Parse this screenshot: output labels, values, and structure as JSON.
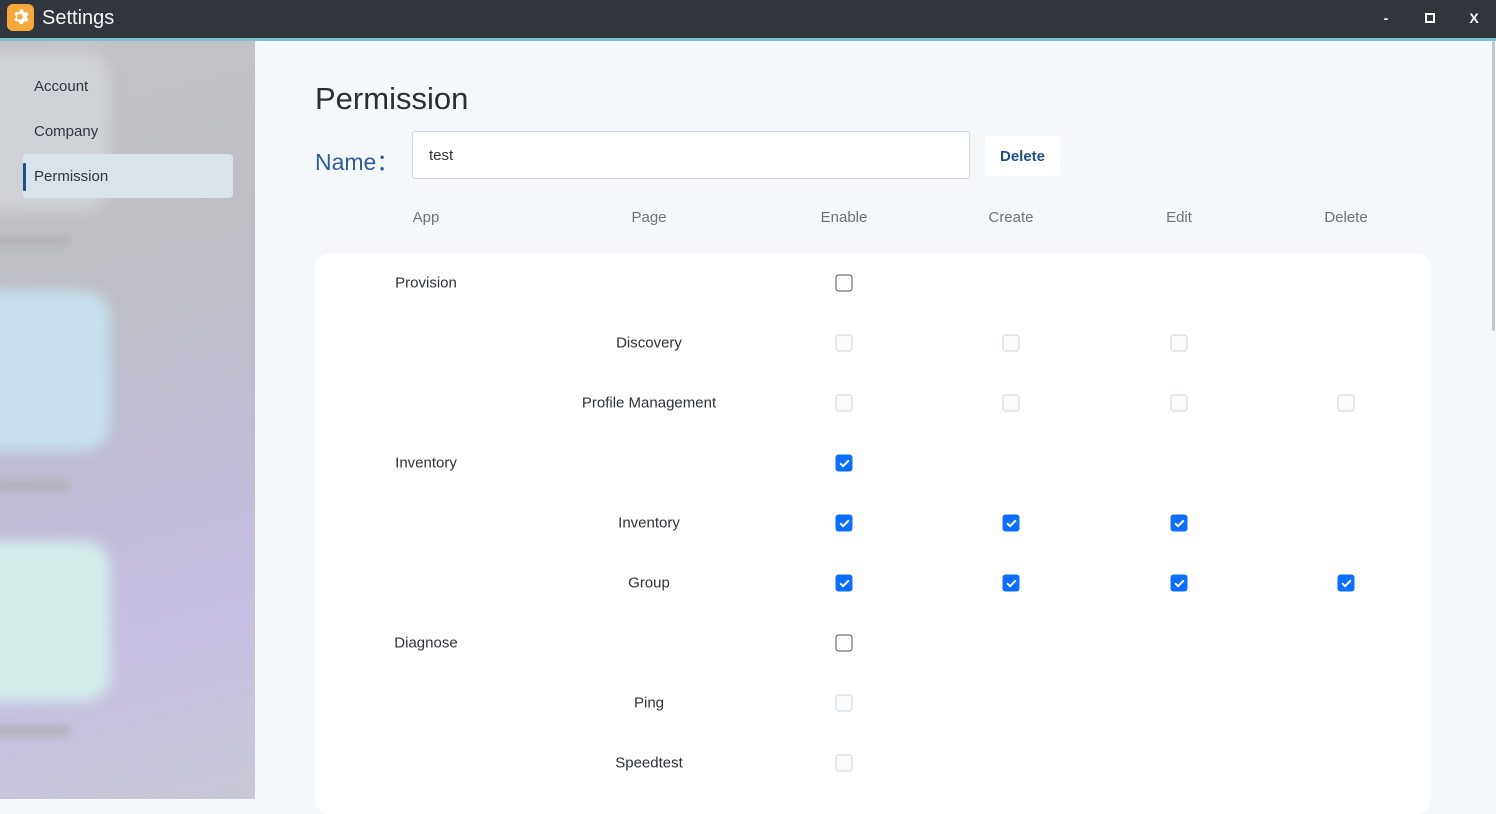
{
  "window": {
    "title": "Settings",
    "minimize": "-",
    "close": "X"
  },
  "sidebar": {
    "items": [
      {
        "label": "Account"
      },
      {
        "label": "Company"
      },
      {
        "label": "Permission"
      }
    ],
    "active": "Permission"
  },
  "main": {
    "title": "Permission",
    "name_label": "Name：",
    "name_value": "test",
    "delete_label": "Delete",
    "columns": [
      "App",
      "Page",
      "Enable",
      "Create",
      "Edit",
      "Delete"
    ],
    "rows": [
      {
        "app": "Provision",
        "page": "",
        "enable": "unchecked",
        "create": "none",
        "edit": "none",
        "delete": "none"
      },
      {
        "app": "",
        "page": "Discovery",
        "enable": "disabled",
        "create": "disabled",
        "edit": "disabled",
        "delete": "none"
      },
      {
        "app": "",
        "page": "Profile Management",
        "enable": "disabled",
        "create": "disabled",
        "edit": "disabled",
        "delete": "disabled"
      },
      {
        "app": "Inventory",
        "page": "",
        "enable": "checked",
        "create": "none",
        "edit": "none",
        "delete": "none"
      },
      {
        "app": "",
        "page": "Inventory",
        "enable": "checked",
        "create": "checked",
        "edit": "checked",
        "delete": "none"
      },
      {
        "app": "",
        "page": "Group",
        "enable": "checked",
        "create": "checked",
        "edit": "checked",
        "delete": "checked"
      },
      {
        "app": "Diagnose",
        "page": "",
        "enable": "unchecked",
        "create": "none",
        "edit": "none",
        "delete": "none"
      },
      {
        "app": "",
        "page": "Ping",
        "enable": "disabled",
        "create": "none",
        "edit": "none",
        "delete": "none"
      },
      {
        "app": "",
        "page": "Speedtest",
        "enable": "disabled",
        "create": "none",
        "edit": "none",
        "delete": "none"
      }
    ]
  },
  "colors": {
    "accent": "#0d6efd",
    "title_bar": "#31363d",
    "label_blue": "#2f5d9a"
  },
  "icons": {
    "app": "gear-icon",
    "checkbox_check": "check-icon"
  }
}
